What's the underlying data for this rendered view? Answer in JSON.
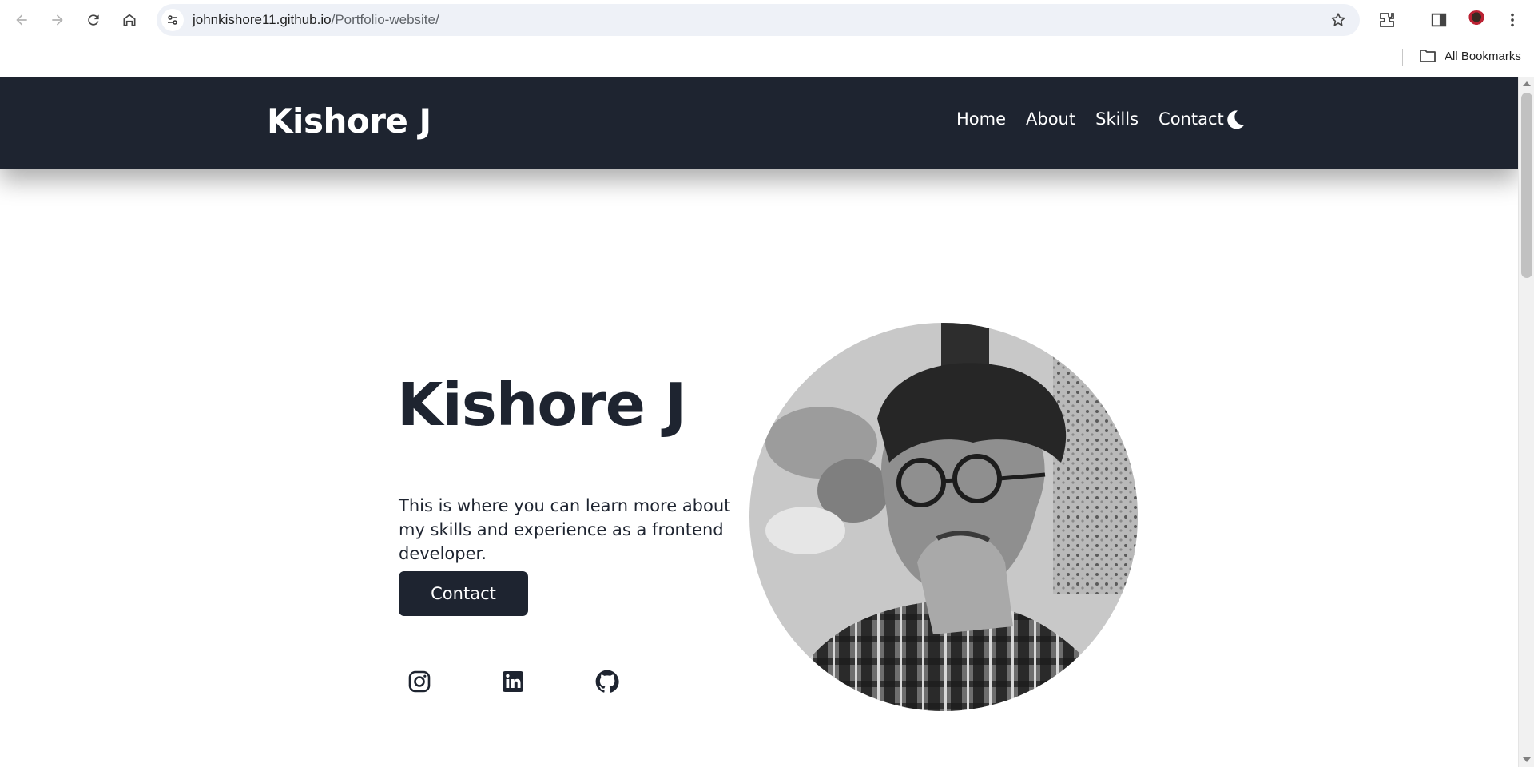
{
  "browser": {
    "url_host": "johnkishore11.github.io",
    "url_path": "/Portfolio-website/",
    "bookmarks_label": "All Bookmarks"
  },
  "site": {
    "logo": "Kishore J",
    "nav": [
      "Home",
      "About",
      "Skills",
      "Contact"
    ],
    "theme_toggle_icon": "moon-icon"
  },
  "hero": {
    "name": "Kishore J",
    "description": "This is where you can learn more about my skills and experience as a frontend developer.",
    "button_label": "Contact",
    "social_icons": [
      "instagram-icon",
      "linkedin-icon",
      "github-icon"
    ]
  },
  "colors": {
    "header_bg": "#1e2430",
    "text_dark": "#1e2430",
    "page_bg": "#ffffff"
  }
}
